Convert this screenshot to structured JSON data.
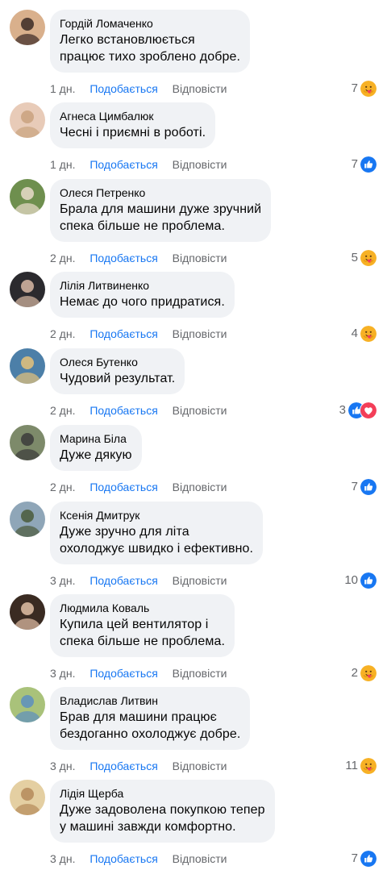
{
  "labels": {
    "like": "Подобається",
    "reply": "Відповісти"
  },
  "colors": {
    "bubble": "#f0f2f5",
    "link": "#1877f2",
    "meta": "#65676b",
    "like_reaction": "#1877f2",
    "love_reaction": "#f33e58",
    "care_reaction": "#f7b125"
  },
  "comments": [
    {
      "author": "Гордій Ломаченко",
      "text": "Легко встановлюється\nпрацює тихо зроблено добре.",
      "time": "1 дн.",
      "reaction_count": "7",
      "reactions": [
        "care-icon"
      ],
      "avatar": [
        "#d9b08c",
        "#3a2a25"
      ]
    },
    {
      "author": "Агнеса Цимбалюк",
      "text": "Чесні і приємні в роботі.",
      "time": "1 дн.",
      "reaction_count": "7",
      "reactions": [
        "like-icon"
      ],
      "avatar": [
        "#e8cbb8",
        "#c9a27e"
      ]
    },
    {
      "author": "Олеся Петренко",
      "text": "Брала для машини дуже зручний\nспека більше не проблема.",
      "time": "2 дн.",
      "reaction_count": "5",
      "reactions": [
        "care-icon"
      ],
      "avatar": [
        "#6e8f4e",
        "#e9dccb"
      ]
    },
    {
      "author": "Лілія Литвиненко",
      "text": "Немає до чого придратися.",
      "time": "2 дн.",
      "reaction_count": "4",
      "reactions": [
        "care-icon"
      ],
      "avatar": [
        "#2b2a2e",
        "#d8b9a4"
      ]
    },
    {
      "author": "Олеся Бутенко",
      "text": "Чудовий результат.",
      "time": "2 дн.",
      "reaction_count": "3",
      "reactions": [
        "like-icon",
        "love-icon"
      ],
      "avatar": [
        "#4c7fa8",
        "#e6c27a"
      ]
    },
    {
      "author": "Марина Біла",
      "text": "Дуже дякую",
      "time": "2 дн.",
      "reaction_count": "7",
      "reactions": [
        "like-icon"
      ],
      "avatar": [
        "#7d8a6a",
        "#3b3b3b"
      ]
    },
    {
      "author": "Ксенія Дмитрук",
      "text": "Дуже зручно для літа\nохолоджує швидко і ефективно.",
      "time": "3 дн.",
      "reaction_count": "10",
      "reactions": [
        "like-icon"
      ],
      "avatar": [
        "#8fa6b8",
        "#4a5a3a"
      ]
    },
    {
      "author": "Людмила Коваль",
      "text": "Купила цей вентилятор і\nспека більше не проблема.",
      "time": "3 дн.",
      "reaction_count": "2",
      "reactions": [
        "care-icon"
      ],
      "avatar": [
        "#3a2b22",
        "#e2c1a6"
      ]
    },
    {
      "author": "Владислав Литвин",
      "text": "Брав для машини працює\nбездоганно охолоджує добре.",
      "time": "3 дн.",
      "reaction_count": "11",
      "reactions": [
        "care-icon"
      ],
      "avatar": [
        "#a9c27a",
        "#5d8fc0"
      ]
    },
    {
      "author": "Лідія Щерба",
      "text": "Дуже задоволена покупкою тепер\nу машині завжди комфортно.",
      "time": "3 дн.",
      "reaction_count": "7",
      "reactions": [
        "like-icon"
      ],
      "avatar": [
        "#e4cfa2",
        "#b58a5a"
      ]
    }
  ]
}
